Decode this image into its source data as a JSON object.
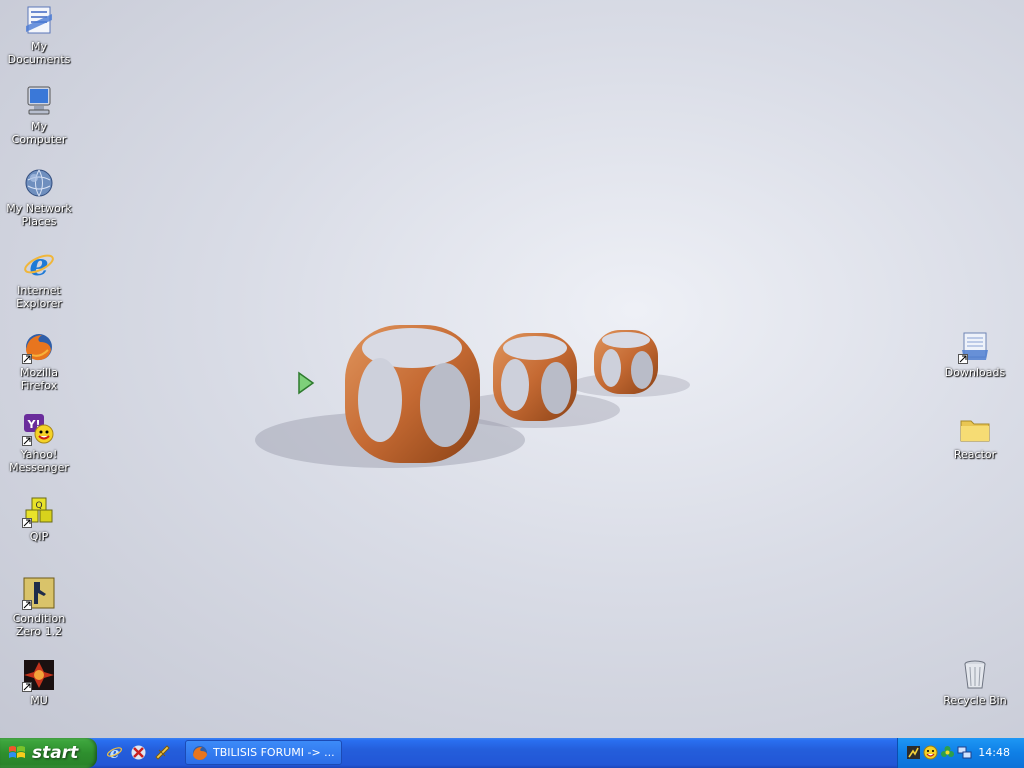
{
  "desktop": {
    "left_icons": [
      {
        "label": "My Documents"
      },
      {
        "label": "My Computer"
      },
      {
        "label": "My Network Places"
      },
      {
        "label": "Internet Explorer"
      },
      {
        "label": "Mozilla Firefox"
      },
      {
        "label": "Yahoo! Messenger"
      },
      {
        "label": "QIP"
      },
      {
        "label": "Condition Zero 1.2"
      },
      {
        "label": "MU"
      }
    ],
    "right_icons": [
      {
        "label": "Downloads"
      },
      {
        "label": "Reactor"
      },
      {
        "label": "Recycle Bin"
      }
    ]
  },
  "taskbar": {
    "start_label": "start",
    "quick_launch": [
      "ie-icon",
      "media-player-icon",
      "messenger-icon"
    ],
    "task": {
      "label": "TBILISIS FORUMI -> ...",
      "icon": "firefox-icon"
    },
    "tray_icons": [
      "network-icon",
      "yahoo-icon",
      "qip-icon",
      "connection-icon"
    ],
    "clock": "14:48"
  },
  "colors": {
    "taskbar_blue": "#245edb",
    "start_green": "#2e8f2e",
    "tray_blue": "#0f7fe6"
  }
}
